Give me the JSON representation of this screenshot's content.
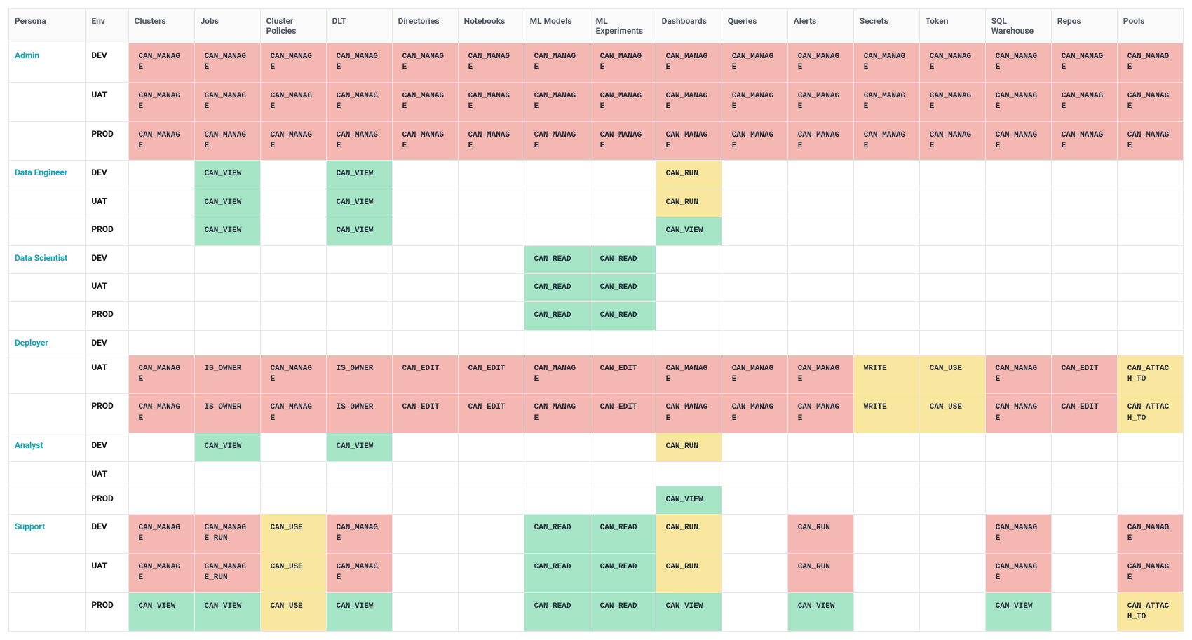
{
  "columns": [
    "Persona",
    "Env",
    "Clusters",
    "Jobs",
    "Cluster Policies",
    "DLT",
    "Directories",
    "Notebooks",
    "ML Models",
    "ML Experiments",
    "Dashboards",
    "Queries",
    "Alerts",
    "Secrets",
    "Token",
    "SQL Warehouse",
    "Repos",
    "Pools"
  ],
  "colors": {
    "red": "#f5b7b1",
    "green": "#a6e6c6",
    "yellow": "#f9e79f"
  },
  "rows": [
    {
      "persona": "Admin",
      "env": "DEV",
      "cells": [
        {
          "t": "CAN_MANAGE",
          "c": "red"
        },
        {
          "t": "CAN_MANAGE",
          "c": "red"
        },
        {
          "t": "CAN_MANAGE",
          "c": "red"
        },
        {
          "t": "CAN_MANAGE",
          "c": "red"
        },
        {
          "t": "CAN_MANAGE",
          "c": "red"
        },
        {
          "t": "CAN_MANAGE",
          "c": "red"
        },
        {
          "t": "CAN_MANAGE",
          "c": "red"
        },
        {
          "t": "CAN_MANAGE",
          "c": "red"
        },
        {
          "t": "CAN_MANAGE",
          "c": "red"
        },
        {
          "t": "CAN_MANAGE",
          "c": "red"
        },
        {
          "t": "CAN_MANAGE",
          "c": "red"
        },
        {
          "t": "CAN_MANAGE",
          "c": "red"
        },
        {
          "t": "CAN_MANAGE",
          "c": "red"
        },
        {
          "t": "CAN_MANAGE",
          "c": "red"
        },
        {
          "t": "CAN_MANAGE",
          "c": "red"
        },
        {
          "t": "CAN_MANAGE",
          "c": "red"
        }
      ]
    },
    {
      "persona": "",
      "env": "UAT",
      "cells": [
        {
          "t": "CAN_MANAGE",
          "c": "red"
        },
        {
          "t": "CAN_MANAGE",
          "c": "red"
        },
        {
          "t": "CAN_MANAGE",
          "c": "red"
        },
        {
          "t": "CAN_MANAGE",
          "c": "red"
        },
        {
          "t": "CAN_MANAGE",
          "c": "red"
        },
        {
          "t": "CAN_MANAGE",
          "c": "red"
        },
        {
          "t": "CAN_MANAGE",
          "c": "red"
        },
        {
          "t": "CAN_MANAGE",
          "c": "red"
        },
        {
          "t": "CAN_MANAGE",
          "c": "red"
        },
        {
          "t": "CAN_MANAGE",
          "c": "red"
        },
        {
          "t": "CAN_MANAGE",
          "c": "red"
        },
        {
          "t": "CAN_MANAGE",
          "c": "red"
        },
        {
          "t": "CAN_MANAGE",
          "c": "red"
        },
        {
          "t": "CAN_MANAGE",
          "c": "red"
        },
        {
          "t": "CAN_MANAGE",
          "c": "red"
        },
        {
          "t": "CAN_MANAGE",
          "c": "red"
        }
      ]
    },
    {
      "persona": "",
      "env": "PROD",
      "cells": [
        {
          "t": "CAN_MANAGE",
          "c": "red"
        },
        {
          "t": "CAN_MANAGE",
          "c": "red"
        },
        {
          "t": "CAN_MANAGE",
          "c": "red"
        },
        {
          "t": "CAN_MANAGE",
          "c": "red"
        },
        {
          "t": "CAN_MANAGE",
          "c": "red"
        },
        {
          "t": "CAN_MANAGE",
          "c": "red"
        },
        {
          "t": "CAN_MANAGE",
          "c": "red"
        },
        {
          "t": "CAN_MANAGE",
          "c": "red"
        },
        {
          "t": "CAN_MANAGE",
          "c": "red"
        },
        {
          "t": "CAN_MANAGE",
          "c": "red"
        },
        {
          "t": "CAN_MANAGE",
          "c": "red"
        },
        {
          "t": "CAN_MANAGE",
          "c": "red"
        },
        {
          "t": "CAN_MANAGE",
          "c": "red"
        },
        {
          "t": "CAN_MANAGE",
          "c": "red"
        },
        {
          "t": "CAN_MANAGE",
          "c": "red"
        },
        {
          "t": "CAN_MANAGE",
          "c": "red"
        }
      ]
    },
    {
      "persona": "Data Engineer",
      "env": "DEV",
      "cells": [
        {},
        {
          "t": "CAN_VIEW",
          "c": "green"
        },
        {},
        {
          "t": "CAN_VIEW",
          "c": "green"
        },
        {},
        {},
        {},
        {},
        {
          "t": "CAN_RUN",
          "c": "yellow"
        },
        {},
        {},
        {},
        {},
        {},
        {},
        {}
      ]
    },
    {
      "persona": "",
      "env": "UAT",
      "cells": [
        {},
        {
          "t": "CAN_VIEW",
          "c": "green"
        },
        {},
        {
          "t": "CAN_VIEW",
          "c": "green"
        },
        {},
        {},
        {},
        {},
        {
          "t": "CAN_RUN",
          "c": "yellow"
        },
        {},
        {},
        {},
        {},
        {},
        {},
        {}
      ]
    },
    {
      "persona": "",
      "env": "PROD",
      "cells": [
        {},
        {
          "t": "CAN_VIEW",
          "c": "green"
        },
        {},
        {
          "t": "CAN_VIEW",
          "c": "green"
        },
        {},
        {},
        {},
        {},
        {
          "t": "CAN_VIEW",
          "c": "green"
        },
        {},
        {},
        {},
        {},
        {},
        {},
        {}
      ]
    },
    {
      "persona": "Data Scientist",
      "env": "DEV",
      "cells": [
        {},
        {},
        {},
        {},
        {},
        {},
        {
          "t": "CAN_READ",
          "c": "green"
        },
        {
          "t": "CAN_READ",
          "c": "green"
        },
        {},
        {},
        {},
        {},
        {},
        {},
        {},
        {}
      ]
    },
    {
      "persona": "",
      "env": "UAT",
      "cells": [
        {},
        {},
        {},
        {},
        {},
        {},
        {
          "t": "CAN_READ",
          "c": "green"
        },
        {
          "t": "CAN_READ",
          "c": "green"
        },
        {},
        {},
        {},
        {},
        {},
        {},
        {},
        {}
      ]
    },
    {
      "persona": "",
      "env": "PROD",
      "cells": [
        {},
        {},
        {},
        {},
        {},
        {},
        {
          "t": "CAN_READ",
          "c": "green"
        },
        {
          "t": "CAN_READ",
          "c": "green"
        },
        {},
        {},
        {},
        {},
        {},
        {},
        {},
        {}
      ]
    },
    {
      "persona": "Deployer",
      "env": "DEV",
      "cells": [
        {},
        {},
        {},
        {},
        {},
        {},
        {},
        {},
        {},
        {},
        {},
        {},
        {},
        {},
        {},
        {}
      ]
    },
    {
      "persona": "",
      "env": "UAT",
      "cells": [
        {
          "t": "CAN_MANAGE",
          "c": "red"
        },
        {
          "t": "IS_OWNER",
          "c": "red"
        },
        {
          "t": "CAN_MANAGE",
          "c": "red"
        },
        {
          "t": "IS_OWNER",
          "c": "red"
        },
        {
          "t": "CAN_EDIT",
          "c": "red"
        },
        {
          "t": "CAN_EDIT",
          "c": "red"
        },
        {
          "t": "CAN_MANAGE",
          "c": "red"
        },
        {
          "t": "CAN_EDIT",
          "c": "red"
        },
        {
          "t": "CAN_MANAGE",
          "c": "red"
        },
        {
          "t": "CAN_MANAGE",
          "c": "red"
        },
        {
          "t": "CAN_MANAGE",
          "c": "red"
        },
        {
          "t": "WRITE",
          "c": "yellow"
        },
        {
          "t": "CAN_USE",
          "c": "yellow"
        },
        {
          "t": "CAN_MANAGE",
          "c": "red"
        },
        {
          "t": "CAN_EDIT",
          "c": "red"
        },
        {
          "t": "CAN_ATTACH_TO",
          "c": "yellow"
        }
      ]
    },
    {
      "persona": "",
      "env": "PROD",
      "cells": [
        {
          "t": "CAN_MANAGE",
          "c": "red"
        },
        {
          "t": "IS_OWNER",
          "c": "red"
        },
        {
          "t": "CAN_MANAGE",
          "c": "red"
        },
        {
          "t": "IS_OWNER",
          "c": "red"
        },
        {
          "t": "CAN_EDIT",
          "c": "red"
        },
        {
          "t": "CAN_EDIT",
          "c": "red"
        },
        {
          "t": "CAN_MANAGE",
          "c": "red"
        },
        {
          "t": "CAN_EDIT",
          "c": "red"
        },
        {
          "t": "CAN_MANAGE",
          "c": "red"
        },
        {
          "t": "CAN_MANAGE",
          "c": "red"
        },
        {
          "t": "CAN_MANAGE",
          "c": "red"
        },
        {
          "t": "WRITE",
          "c": "yellow"
        },
        {
          "t": "CAN_USE",
          "c": "yellow"
        },
        {
          "t": "CAN_MANAGE",
          "c": "red"
        },
        {
          "t": "CAN_EDIT",
          "c": "red"
        },
        {
          "t": "CAN_ATTACH_TO",
          "c": "yellow"
        }
      ]
    },
    {
      "persona": "Analyst",
      "env": "DEV",
      "cells": [
        {},
        {
          "t": "CAN_VIEW",
          "c": "green"
        },
        {},
        {
          "t": "CAN_VIEW",
          "c": "green"
        },
        {},
        {},
        {},
        {},
        {
          "t": "CAN_RUN",
          "c": "yellow"
        },
        {},
        {},
        {},
        {},
        {},
        {},
        {}
      ]
    },
    {
      "persona": "",
      "env": "UAT",
      "cells": [
        {},
        {},
        {},
        {},
        {},
        {},
        {},
        {},
        {},
        {},
        {},
        {},
        {},
        {},
        {},
        {}
      ]
    },
    {
      "persona": "",
      "env": "PROD",
      "cells": [
        {},
        {},
        {},
        {},
        {},
        {},
        {},
        {},
        {
          "t": "CAN_VIEW",
          "c": "green"
        },
        {},
        {},
        {},
        {},
        {},
        {},
        {}
      ]
    },
    {
      "persona": "Support",
      "env": "DEV",
      "cells": [
        {
          "t": "CAN_MANAGE",
          "c": "red"
        },
        {
          "t": "CAN_MANAGE_RUN",
          "c": "red"
        },
        {
          "t": "CAN_USE",
          "c": "yellow"
        },
        {
          "t": "CAN_MANAGE",
          "c": "red"
        },
        {},
        {},
        {
          "t": "CAN_READ",
          "c": "green"
        },
        {
          "t": "CAN_READ",
          "c": "green"
        },
        {
          "t": "CAN_RUN",
          "c": "yellow"
        },
        {},
        {
          "t": "CAN_RUN",
          "c": "red"
        },
        {},
        {},
        {
          "t": "CAN_MANAGE",
          "c": "red"
        },
        {},
        {
          "t": "CAN_MANAGE",
          "c": "red"
        }
      ]
    },
    {
      "persona": "",
      "env": "UAT",
      "cells": [
        {
          "t": "CAN_MANAGE",
          "c": "red"
        },
        {
          "t": "CAN_MANAGE_RUN",
          "c": "red"
        },
        {
          "t": "CAN_USE",
          "c": "yellow"
        },
        {
          "t": "CAN_MANAGE",
          "c": "red"
        },
        {},
        {},
        {
          "t": "CAN_READ",
          "c": "green"
        },
        {
          "t": "CAN_READ",
          "c": "green"
        },
        {
          "t": "CAN_RUN",
          "c": "yellow"
        },
        {},
        {
          "t": "CAN_RUN",
          "c": "red"
        },
        {},
        {},
        {
          "t": "CAN_MANAGE",
          "c": "red"
        },
        {},
        {
          "t": "CAN_MANAGE",
          "c": "red"
        }
      ]
    },
    {
      "persona": "",
      "env": "PROD",
      "cells": [
        {
          "t": "CAN_VIEW",
          "c": "green"
        },
        {
          "t": "CAN_VIEW",
          "c": "green"
        },
        {
          "t": "CAN_USE",
          "c": "yellow"
        },
        {
          "t": "CAN_VIEW",
          "c": "green"
        },
        {},
        {},
        {
          "t": "CAN_READ",
          "c": "green"
        },
        {
          "t": "CAN_READ",
          "c": "green"
        },
        {
          "t": "CAN_VIEW",
          "c": "green"
        },
        {},
        {
          "t": "CAN_VIEW",
          "c": "green"
        },
        {},
        {},
        {
          "t": "CAN_VIEW",
          "c": "green"
        },
        {},
        {
          "t": "CAN_ATTACH_TO",
          "c": "yellow"
        }
      ]
    }
  ]
}
